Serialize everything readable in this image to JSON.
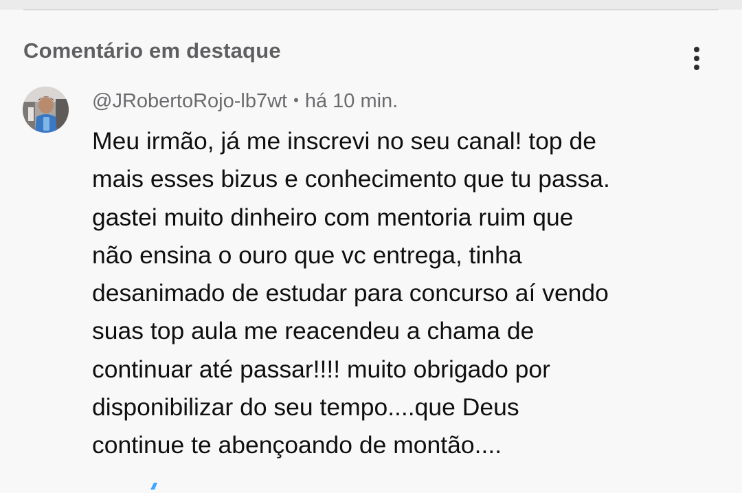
{
  "header": {
    "section_title": "Comentário em destaque",
    "more_icon": "vertical-ellipsis-icon"
  },
  "comment": {
    "author_handle": "@JRobertoRojo-lb7wt",
    "separator": "•",
    "timestamp": "há 10 min.",
    "avatar_icon": "user-avatar-photo",
    "text_lines": [
      "Meu irmão, já me inscrevi no seu canal! top de",
      "mais esses bizus e conhecimento que tu passa.",
      "gastei muito dinheiro com mentoria ruim que",
      "não ensina o ouro que vc entrega, tinha",
      "desanimado de estudar para concurso aí vendo",
      "suas top aula me reacendeu a chama de",
      "continuar até passar!!!! muito obrigado por",
      "disponibilizar do seu tempo....que Deus",
      "continue te abençoando de montão...."
    ]
  },
  "footer": {
    "partial_icon": "like-icon"
  },
  "colors": {
    "background": "#f8f8f9",
    "title_gray": "#5f5f61",
    "meta_gray": "#6b6b6e",
    "text": "#0f0f0f",
    "accent_blue": "#3ea6ff"
  }
}
